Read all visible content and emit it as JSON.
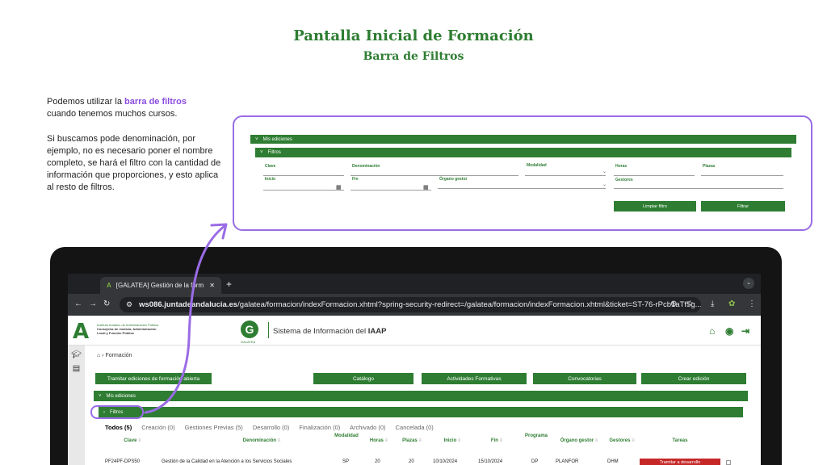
{
  "heading": {
    "title": "Pantalla Inicial de Formación",
    "subtitle": "Barra de Filtros"
  },
  "intro": {
    "p1_pre": "Podemos utilizar la ",
    "p1_highlight": "barra de filtros",
    "p1_post": "cuando tenemos muchos cursos.",
    "p2": "Si buscamos pode denominación, por ejemplo, no es necesario poner el nombre completo, se hará el filtro con la  cantidad de información que proporciones, y esto aplica al resto de filtros."
  },
  "zoom_panel": {
    "section_label": "Mis ediciones",
    "filters_label": "Filtros",
    "fields": {
      "clave": "Clave",
      "denominacion": "Denominación",
      "modalidad": "Modalidad",
      "horas": "Horas",
      "plazas": "Plazas",
      "inicio": "Inicio",
      "fin": "Fin",
      "organo_gestor": "Órgano gestor",
      "gestores": "Gestores"
    },
    "clear_button": "Limpiar filtro",
    "filter_button": "Filtrar"
  },
  "browser": {
    "tab_title": "[GALATEA] Gestión de la form",
    "url_host": "ws086.juntadeandalucia.es",
    "url_path": "/galatea/formacion/indexFormacion.xhtml?spring-security-redirect=/galatea/formacion/indexFormacion.xhtml&ticket=ST-76-rPcb1aTf5g..."
  },
  "app": {
    "inst_line1": "Instituto Andaluz de Administración Pública",
    "inst_line2": "Consejería de Justicia, Administración",
    "inst_line3": "Local y Función Pública",
    "galatea_label": "GALATEA",
    "system_name_pre": "Sistema de Información del ",
    "system_name_bold": "IAAP",
    "breadcrumb": "Formación",
    "buttons": {
      "tramitar": "Tramitar ediciones de formación abierta",
      "catalogo": "Catálogo",
      "actividades": "Actividades Formativas",
      "convocatorias": "Convocatorias",
      "crear": "Crear edición"
    },
    "section_label": "Mis ediciones",
    "filters_label": "Filtros",
    "tabs": [
      "Todos (5)",
      "Creación (0)",
      "Gestiones Previas (5)",
      "Desarrollo (0)",
      "Finalización (0)",
      "Archivado (0)",
      "Cancelada (0)"
    ],
    "columns": {
      "clave": "Clave",
      "denominacion": "Denominación",
      "modalidad": "Modalidad",
      "horas": "Horas",
      "plazas": "Plazas",
      "inicio": "Inicio",
      "fin": "Fin",
      "programa": "Programa",
      "organo": "Órgano gestor",
      "gestores": "Gestores",
      "tareas": "Tareas"
    },
    "row": {
      "clave": "PF24PF-DPS50",
      "denominacion": "Gestión de la Calidad en la Atención a los Servicios Sociales",
      "modalidad": "SP",
      "horas": "20",
      "plazas": "20",
      "inicio": "10/10/2024",
      "fin": "15/10/2024",
      "programa": "DP",
      "organo": "PLANFOR",
      "gestores": "DHM",
      "tarea": "Tramitar a desarrollo"
    }
  },
  "colors": {
    "brand_green": "#2e7d32",
    "accent_purple": "#8a4be0"
  }
}
